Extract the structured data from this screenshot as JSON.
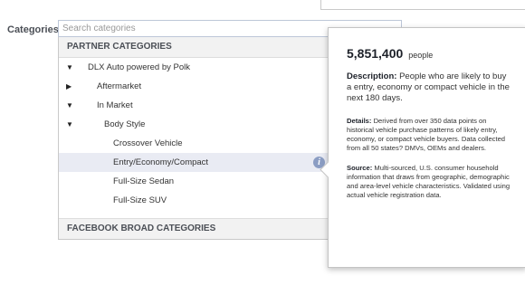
{
  "form": {
    "label": "Categories:",
    "search_placeholder": "Search categories"
  },
  "sections": {
    "partner": "PARTNER CATEGORIES",
    "facebook": "FACEBOOK BROAD CATEGORIES"
  },
  "tree": [
    {
      "label": "DLX Auto powered by Polk",
      "arrow": "▼",
      "level": 0
    },
    {
      "label": "Aftermarket",
      "arrow": "▶",
      "level": 1
    },
    {
      "label": "In Market",
      "arrow": "▼",
      "level": 1
    },
    {
      "label": "Body Style",
      "arrow": "▼",
      "level": 2
    },
    {
      "label": "Crossover Vehicle",
      "arrow": "",
      "level": 3
    },
    {
      "label": "Entry/Economy/Compact",
      "arrow": "",
      "level": 3,
      "selected": true
    },
    {
      "label": "Full-Size Sedan",
      "arrow": "",
      "level": 3
    },
    {
      "label": "Full-Size SUV",
      "arrow": "",
      "level": 3
    }
  ],
  "popover": {
    "audience": "5,851,400",
    "audience_unit": "people",
    "description_label": "Description:",
    "description": "People who are likely to buy a entry, economy or compact vehicle in the next 180 days.",
    "details_label": "Details:",
    "details": "Derived from over 350 data points on historical vehicle purchase patterns of likely entry, economy, or compact vehicle buyers. Data collected from all 50 states? DMVs, OEMs and dealers.",
    "source_label": "Source:",
    "source": "Multi-sourced, U.S. consumer household information that draws from geographic, demographic and area-level vehicle characteristics. Validated using actual vehicle registration data."
  },
  "icons": {
    "info": "info-icon"
  }
}
